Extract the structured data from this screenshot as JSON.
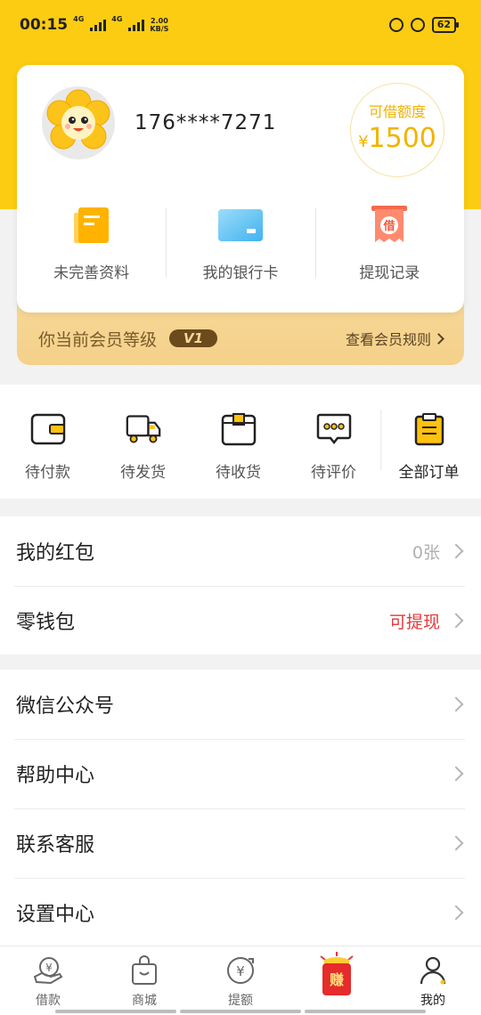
{
  "status_bar": {
    "time": "00:15",
    "net_1": "4G",
    "net_2": "4G",
    "speed_value": "2.00",
    "speed_unit": "KB/S",
    "battery": "62"
  },
  "profile": {
    "phone": "176****7271",
    "credit_label": "可借额度",
    "credit_currency": "¥",
    "credit_amount": "1500"
  },
  "quick_actions": [
    {
      "label": "未完善资料",
      "icon": "document-icon"
    },
    {
      "label": "我的银行卡",
      "icon": "bank-card-icon"
    },
    {
      "label": "提现记录",
      "icon": "borrow-record-icon",
      "badge": "借"
    }
  ],
  "member": {
    "text": "你当前会员等级",
    "level": "V1",
    "link": "查看会员规则"
  },
  "orders": [
    {
      "label": "待付款",
      "icon": "wallet-icon"
    },
    {
      "label": "待发货",
      "icon": "truck-icon"
    },
    {
      "label": "待收货",
      "icon": "package-icon"
    },
    {
      "label": "待评价",
      "icon": "comment-icon"
    },
    {
      "label": "全部订单",
      "icon": "clipboard-icon"
    }
  ],
  "list_1": [
    {
      "label": "我的红包",
      "value": "0张"
    },
    {
      "label": "零钱包",
      "value": "可提现"
    }
  ],
  "list_2": [
    {
      "label": "微信公众号"
    },
    {
      "label": "帮助中心"
    },
    {
      "label": "联系客服"
    },
    {
      "label": "设置中心"
    }
  ],
  "tabbar": [
    {
      "label": "借款",
      "icon": "loan-icon"
    },
    {
      "label": "商城",
      "icon": "shop-bag-icon"
    },
    {
      "label": "提额",
      "icon": "raise-limit-icon"
    },
    {
      "label": "",
      "icon": "earn-red-packet-icon",
      "badge": "赚"
    },
    {
      "label": "我的",
      "icon": "profile-icon",
      "active": true
    }
  ],
  "colors": {
    "brand_yellow": "#fccc12",
    "credit_gold": "#f2b300",
    "member_bg": "#f7d998",
    "accent_red": "#e6393a"
  }
}
